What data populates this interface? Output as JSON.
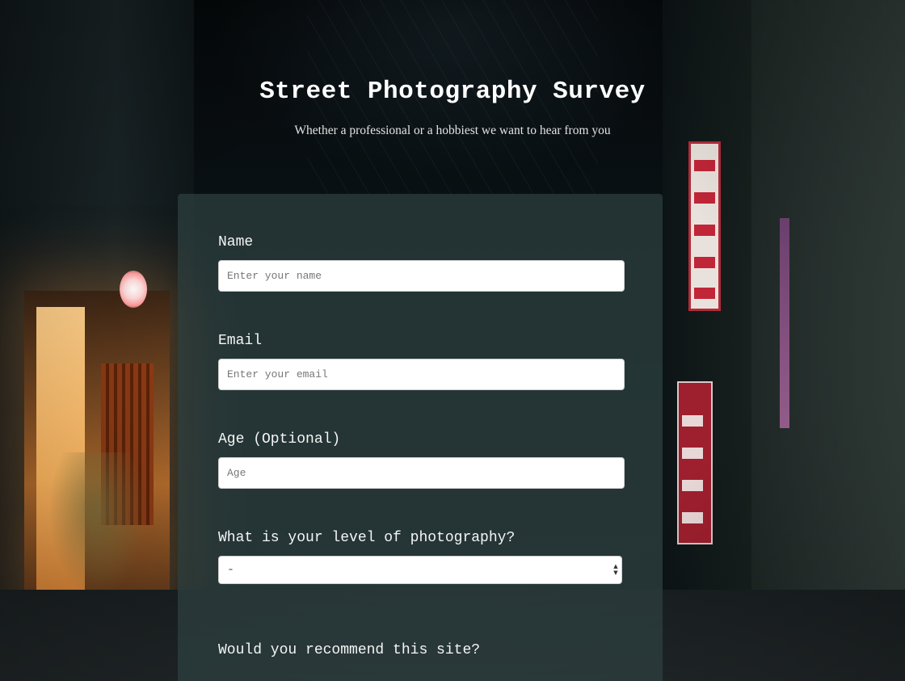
{
  "header": {
    "title": "Street Photography Survey",
    "subtitle": "Whether a professional or a hobbiest we want to hear from you"
  },
  "form": {
    "name": {
      "label": "Name",
      "placeholder": "Enter your name"
    },
    "email": {
      "label": "Email",
      "placeholder": "Enter your email"
    },
    "age": {
      "label": "Age (Optional)",
      "placeholder": "Age"
    },
    "level": {
      "label": "What is your level of photography?",
      "selected": "-"
    },
    "recommend": {
      "label": "Would you recommend this site?"
    }
  },
  "colors": {
    "card_background": "#2e4040",
    "title_text": "#ffffff",
    "input_background": "#ffffff"
  },
  "icons": {
    "select_arrows": "up-down-chevrons-icon"
  }
}
